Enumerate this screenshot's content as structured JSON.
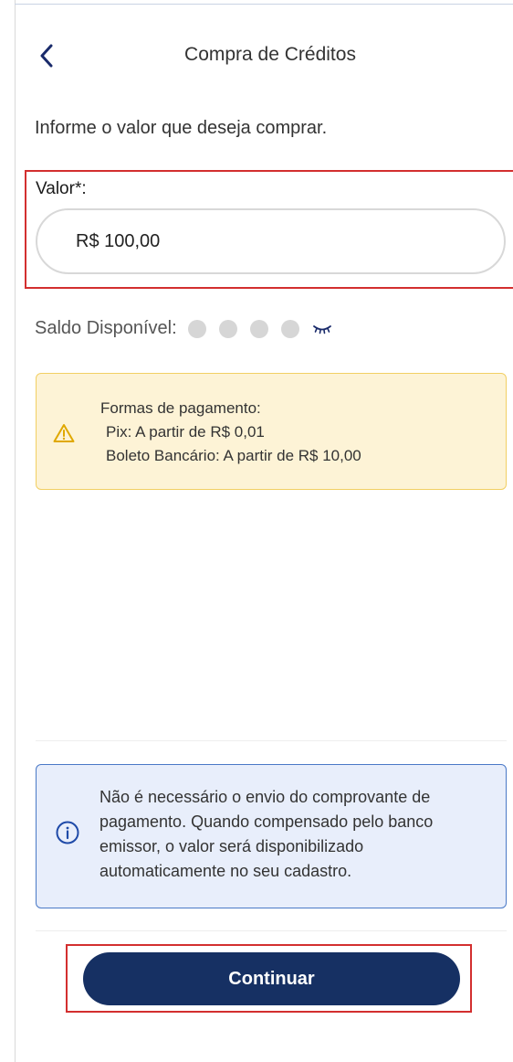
{
  "header": {
    "title": "Compra de Créditos",
    "back_icon": "chevron-left-icon"
  },
  "instruction": "Informe o valor que deseja comprar.",
  "valor": {
    "label": "Valor*:",
    "value": "R$ 100,00"
  },
  "saldo": {
    "label": "Saldo Disponível:",
    "hidden_icon": "eye-closed-icon"
  },
  "warning": {
    "icon": "warning-icon",
    "lines": [
      "Formas de pagamento:",
      "Pix: A partir de R$ 0,01",
      "Boleto Bancário: A partir de R$ 10,00"
    ]
  },
  "info": {
    "icon": "info-icon",
    "text": "Não é necessário o envio do comprovante de pagamento. Quando compensado pelo banco emissor, o valor será disponibilizado automaticamente no seu cadastro."
  },
  "actions": {
    "continue_label": "Continuar"
  },
  "colors": {
    "primary": "#163063",
    "highlight": "#d32f2f",
    "warning_bg": "#fdf3d6",
    "warning_border": "#f2cf63",
    "info_bg": "#e8eefb",
    "info_border": "#4a79c7"
  }
}
